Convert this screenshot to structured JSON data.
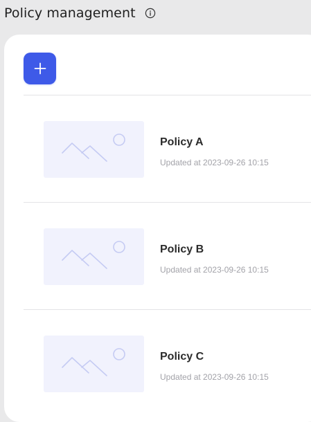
{
  "header": {
    "title": "Policy management",
    "info_icon": "info-icon"
  },
  "toolbar": {
    "add_icon": "plus-icon"
  },
  "colors": {
    "accent": "#3e5ae8",
    "thumbnail_bg": "#f1f2fd",
    "thumbnail_stroke": "#c5cbf3"
  },
  "policies": [
    {
      "name": "Policy A",
      "updated": "Updated at 2023-09-26 10:15",
      "thumbnail_icon": "image-placeholder-icon"
    },
    {
      "name": "Policy B",
      "updated": "Updated at 2023-09-26 10:15",
      "thumbnail_icon": "image-placeholder-icon"
    },
    {
      "name": "Policy C",
      "updated": "Updated at 2023-09-26 10:15",
      "thumbnail_icon": "image-placeholder-icon"
    }
  ]
}
